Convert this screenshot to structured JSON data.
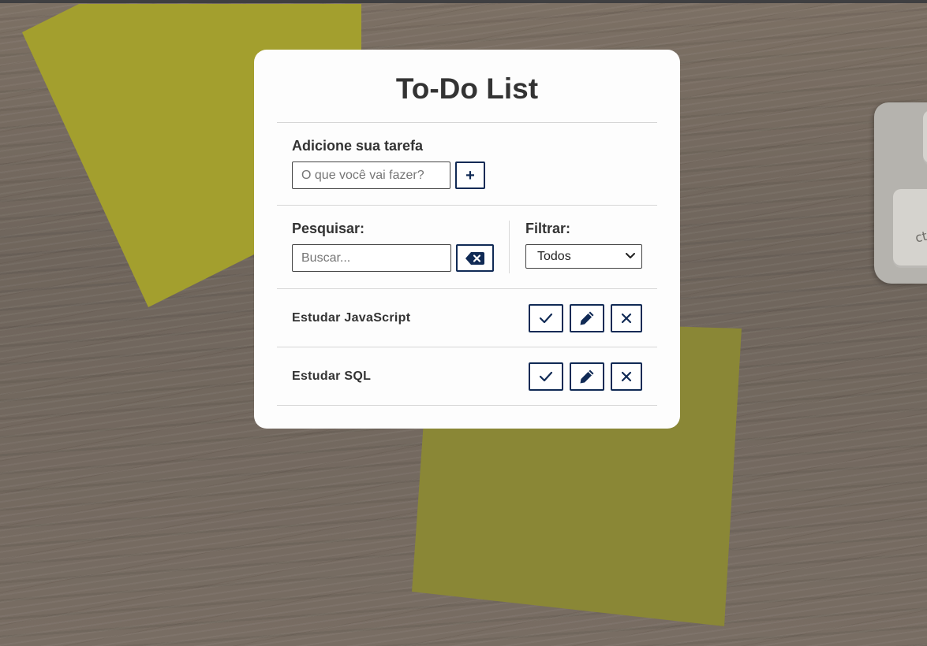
{
  "app": {
    "title": "To-Do List"
  },
  "add_task": {
    "label": "Adicione sua tarefa",
    "input_placeholder": "O que você vai fazer?",
    "input_value": "",
    "add_button_label": "+"
  },
  "search": {
    "label": "Pesquisar:",
    "input_placeholder": "Buscar...",
    "input_value": ""
  },
  "filter": {
    "label": "Filtrar:",
    "selected": "Todos"
  },
  "todos": [
    {
      "title": "Estudar JavaScript"
    },
    {
      "title": "Estudar SQL"
    }
  ],
  "background": {
    "keyboard_key_label": "ctrl"
  },
  "colors": {
    "accent": "#102a55",
    "card": "#fdfdfd",
    "text": "#333333"
  },
  "icons": {
    "done": "check-icon",
    "edit": "pencil-icon",
    "remove": "close-icon",
    "erase": "backspace-icon",
    "dropdown": "chevron-down-icon"
  }
}
